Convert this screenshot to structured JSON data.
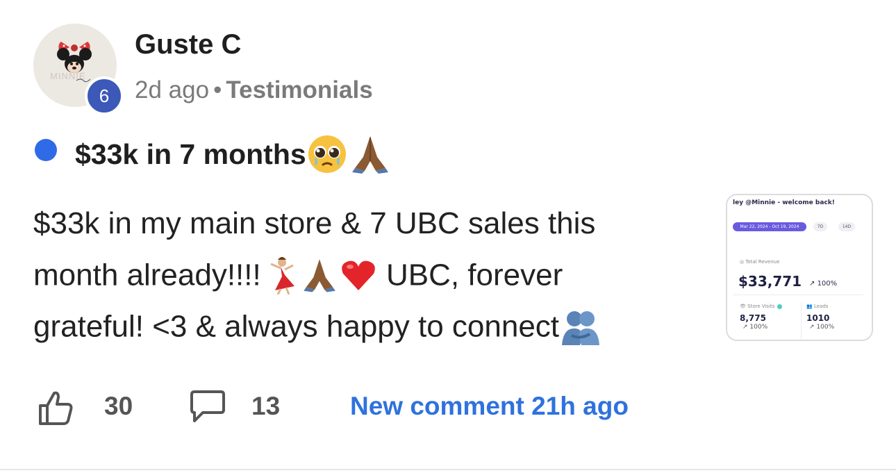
{
  "post": {
    "author": "Guste C",
    "avatar_level": "6",
    "time_ago": "2d ago",
    "separator": "•",
    "category": "Testimonials",
    "title": "$33k in 7 months",
    "body": {
      "line1": "$33k in my main store & 7 UBC sales this",
      "line2_a": "month already!!!!",
      "line2_b": " UBC, forever",
      "line3": "grateful! <3 & always happy to connect"
    },
    "icons": [
      "pleading-face-icon",
      "folded-hands-icon",
      "dancer-icon",
      "red-heart-icon",
      "people-hugging-icon"
    ]
  },
  "thumbnail": {
    "greeting": "ley @Minnie - welcome back!",
    "date_range": "Mar 22, 2024 - Oct 19, 2024",
    "chip_7d": "7D",
    "chip_14d": "14D",
    "total_revenue_label": "Total Revenue",
    "total_revenue_value": "$33,771",
    "total_revenue_change": "100%",
    "store_visits_label": "Store Visits",
    "store_visits_value": "8,775",
    "store_visits_change": "100%",
    "leads_label": "Leads",
    "leads_value": "1010",
    "leads_change": "100%"
  },
  "actions": {
    "likes": "30",
    "comments": "13",
    "new_comment": "New comment 21h ago"
  },
  "colors": {
    "accent_blue": "#2f72dd",
    "unread_dot": "#2f6be6",
    "level_badge": "#3c58b8"
  }
}
